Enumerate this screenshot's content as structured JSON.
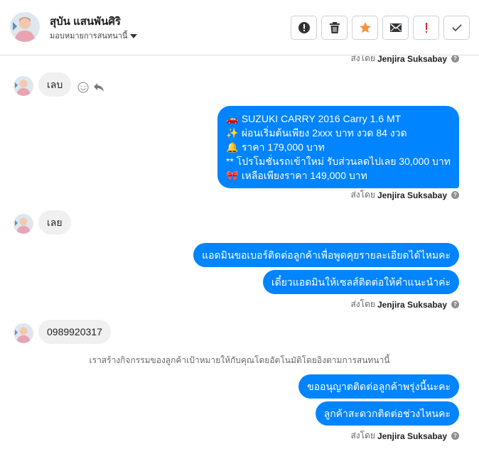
{
  "header": {
    "name": "สุบัน แสนพันศิริ",
    "assign_label": "มอบหมายการสนทนานี้",
    "actions": [
      {
        "name": "spam-button",
        "icon": "alert-circle-icon"
      },
      {
        "name": "delete-button",
        "icon": "trash-icon"
      },
      {
        "name": "star-button",
        "icon": "star-icon"
      },
      {
        "name": "mark-unread-button",
        "icon": "envelope-icon"
      },
      {
        "name": "important-button",
        "icon": "exclamation-icon"
      },
      {
        "name": "done-button",
        "icon": "check-icon"
      }
    ]
  },
  "thread": {
    "sent_by_prefix": "ส่งโดย",
    "agent_name": "Jenjira Suksabay",
    "help_glyph": "?",
    "messages": {
      "in_1": "เลบ",
      "out_card": {
        "lines": [
          {
            "emoji": "🚗",
            "text": " SUZUKI CARRY 2016 Carry 1.6 MT"
          },
          {
            "emoji": "✨",
            "text": " ผ่อนเริ่มต้นเพียง 2xxx บาท งวด 84 งวด"
          },
          {
            "emoji": "🔔",
            "text": "  ราคา 179,000 บาท"
          },
          {
            "emoji": "",
            "text": "** โปรโมชั่นรถเข้าใหม่ รับส่วนลดไปเลย 30,000 บาท"
          },
          {
            "emoji": "🎀",
            "text": " เหลือเพียงราคา 149,000 บาท"
          }
        ]
      },
      "in_2": "เลย",
      "out_2a": "แอดมินขอเบอร์ติดต่อลูกค้าเพื่อพูดคุยรายละเอียดได้ไหมคะ",
      "out_2b": "เดี๋ยวแอดมินให้เซลส์ติดต่อให้คำแนะนำค่ะ",
      "in_3": "0989920317",
      "system_note": "เราสร้างกิจกรรมของลูกค้าเป้าหมายให้กับคุณโดยอัตโนมัติโดยอิงตามการสนทนานี้",
      "out_3a": "ขออนุญาตติดต่อลูกค้าพรุ่งนี้นะคะ",
      "out_3b": "ลูกค้าสะดวกติดต่อช่วงไหนคะ"
    }
  },
  "colors": {
    "accent": "#0084ff",
    "incoming_bubble": "#f0f0f0",
    "star": "#f7923a"
  }
}
